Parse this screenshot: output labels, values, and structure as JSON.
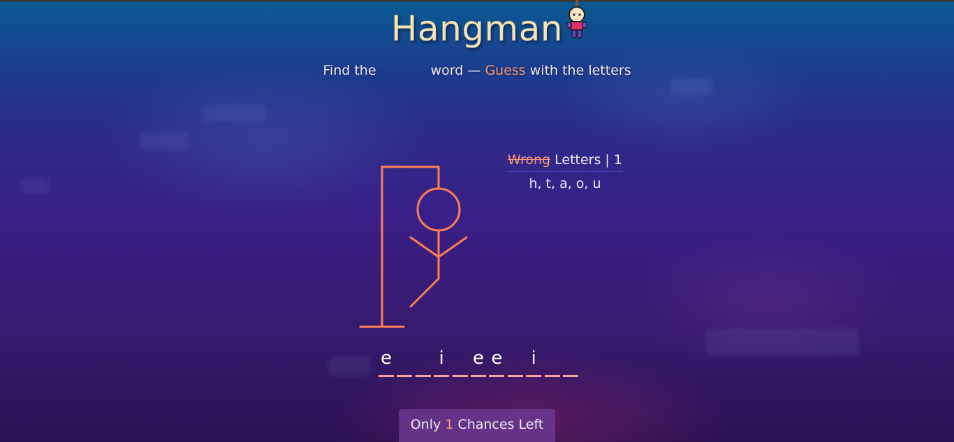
{
  "title": "Hangman",
  "subtitle": {
    "prefix": "Find the",
    "middle": "word —",
    "accent": "Guess",
    "suffix": "with the letters"
  },
  "wrong_letters": {
    "strike_label": "Wrong",
    "label": "Letters |",
    "count": "1",
    "letters": "h, t, a, o, u"
  },
  "word_slots": [
    "e",
    "",
    "",
    "i",
    "",
    "e",
    "e",
    "",
    "i",
    "",
    ""
  ],
  "chances": {
    "prefix": "Only",
    "count": "1",
    "suffix": "Chances Left"
  },
  "colors": {
    "accent": "#ff9a73",
    "title": "#f6e2b3",
    "stickman": "#ff7f50",
    "underline": "#f4a6a0"
  },
  "icons": {
    "mascot": "hanging-character-icon"
  }
}
